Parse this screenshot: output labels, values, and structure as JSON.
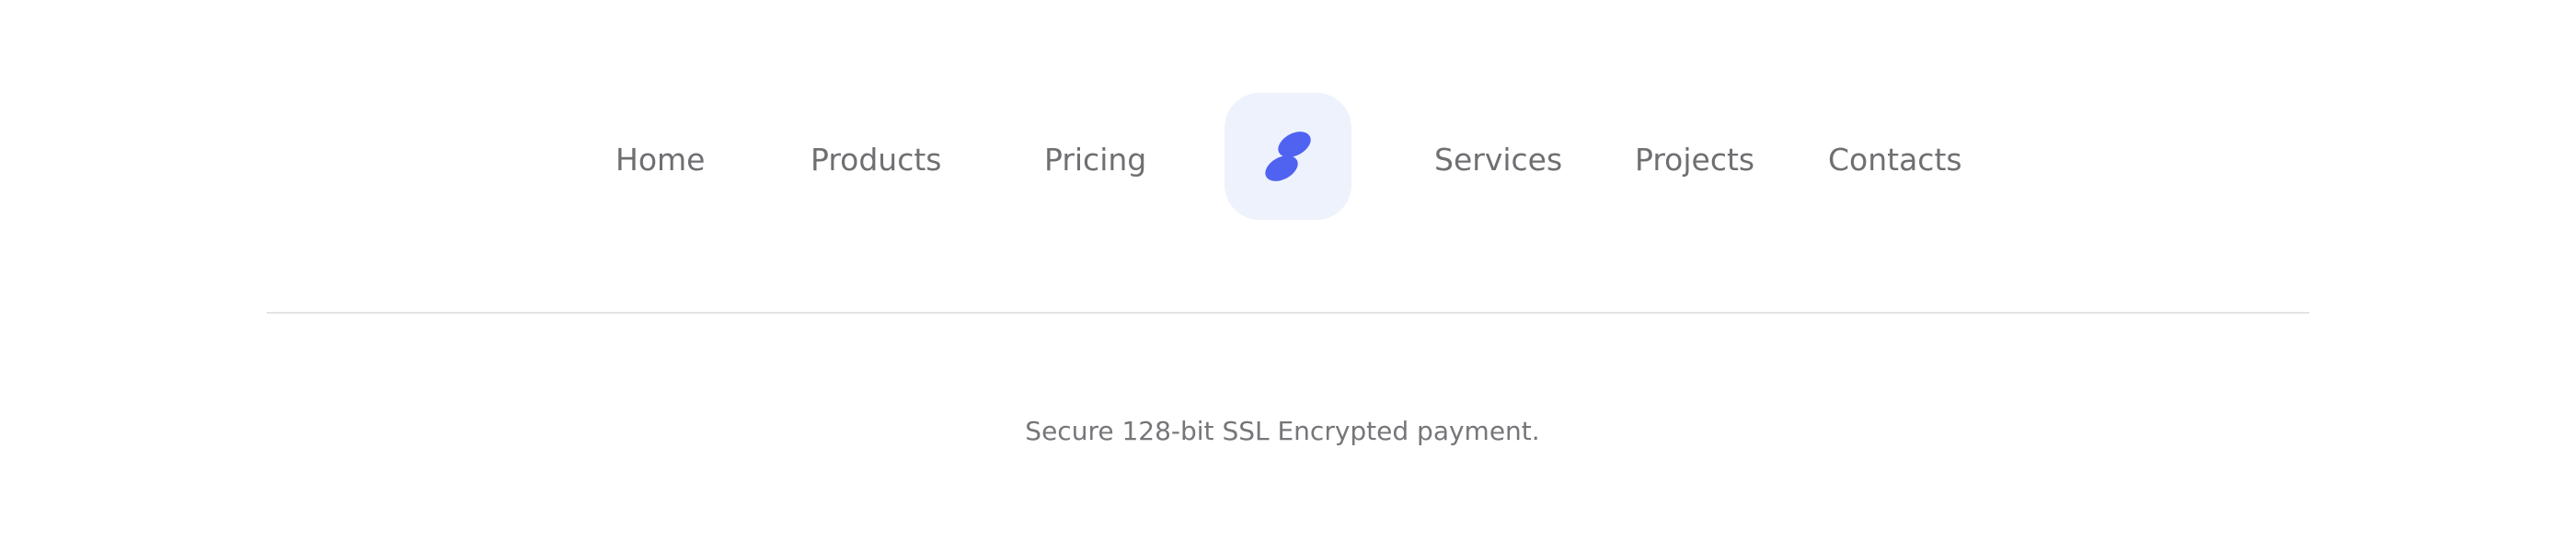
{
  "nav": {
    "items": [
      {
        "label": "Home"
      },
      {
        "label": "Products"
      },
      {
        "label": "Pricing"
      },
      {
        "label": "Services"
      },
      {
        "label": "Projects"
      },
      {
        "label": "Contacts"
      }
    ],
    "logo": {
      "icon": "brand-logo-icon",
      "tile_color": "#eef2fd",
      "mark_color": "#4f62f0"
    }
  },
  "footer": {
    "note": "Secure 128-bit SSL Encrypted payment."
  },
  "colors": {
    "text": "#6f6f73",
    "divider": "#e3e3e6",
    "background": "#ffffff"
  }
}
